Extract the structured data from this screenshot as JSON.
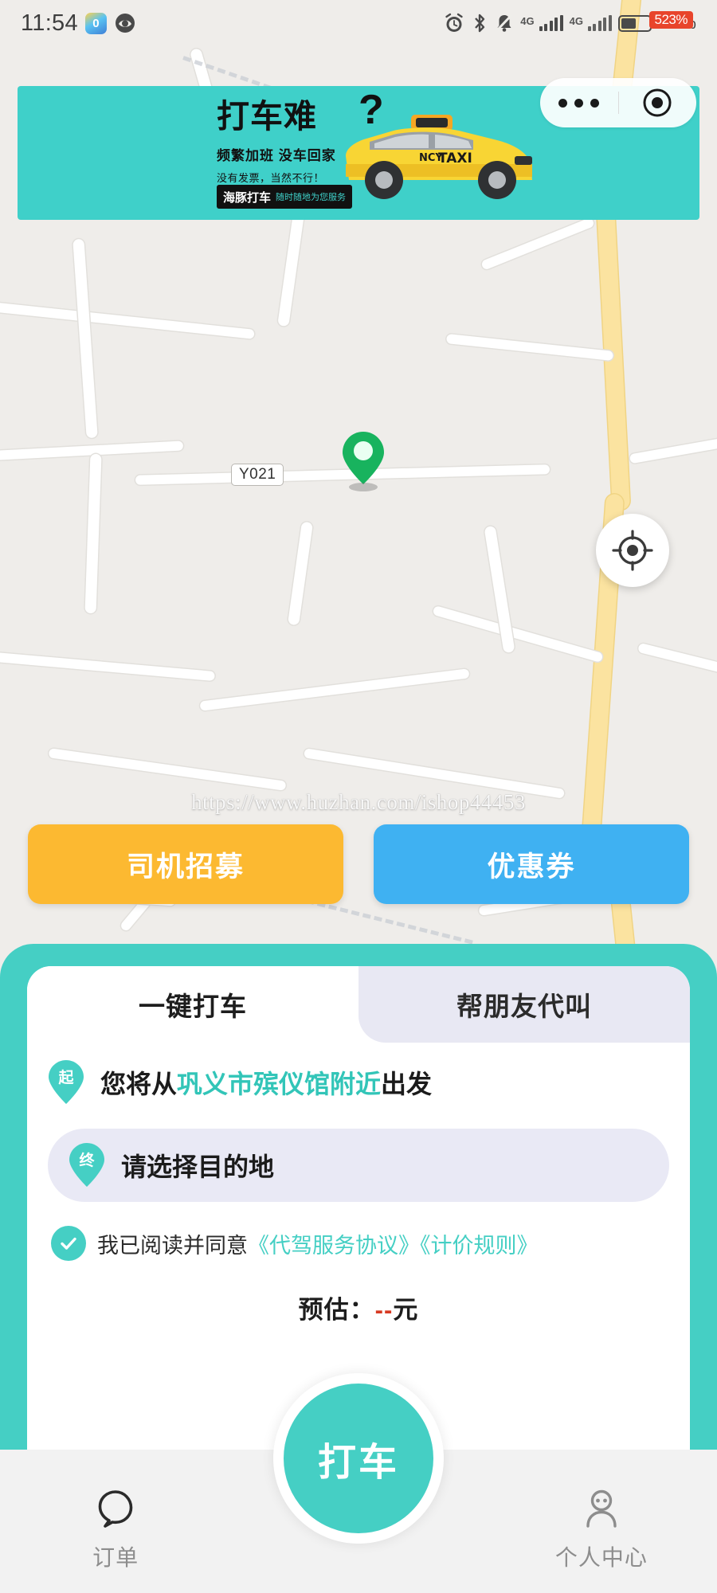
{
  "status_bar": {
    "time": "11:54",
    "app_badge_text": "0",
    "icons": [
      "app-icon",
      "eye-icon",
      "alarm-icon",
      "bluetooth-icon",
      "mute-bell-icon",
      "signal-icon",
      "signal-icon-2",
      "battery-icon"
    ],
    "network_label_1": "4G",
    "network_label_2": "4G",
    "battery_percent": "52%",
    "notification_badge": "523%"
  },
  "capsule": {
    "more_label": "more-dots",
    "target_label": "target-circle"
  },
  "banner": {
    "headline": "打车难",
    "question_mark": "?",
    "subline": "频繁加班  没车回家",
    "subline2": "没有发票，当然不行！",
    "chip_brand": "海豚打车",
    "chip_tag": "随时随地为您服务",
    "taxi_badge": "TAXI",
    "taxi_logo": "NCYTAXI",
    "bg_color": "#3fd0c9"
  },
  "map": {
    "road_label": "Y021",
    "pin_name": "origin-pin",
    "locate_button": "locate-me",
    "watermark": "https://www.huzhan.com/ishop44453"
  },
  "quick_actions": [
    {
      "label": "司机招募",
      "color": "#fcb931",
      "name": "driver-recruit"
    },
    {
      "label": "优惠券",
      "color": "#3fb1f2",
      "name": "coupon"
    }
  ],
  "booking": {
    "tabs": [
      {
        "label": "一键打车",
        "active": true
      },
      {
        "label": "帮朋友代叫",
        "active": false
      }
    ],
    "origin": {
      "pin_text": "起",
      "prefix": "您将从",
      "place": "巩义市殡仪馆附近",
      "suffix": "出发"
    },
    "destination": {
      "pin_text": "终",
      "placeholder": "请选择目的地"
    },
    "agreement": {
      "text": "我已阅读并同意",
      "link1": "《代驾服务协议》",
      "link2": "《计价规则》",
      "checked": true
    },
    "estimate": {
      "label": "预估：",
      "value": "--",
      "unit": "元"
    },
    "cta_label": "打车",
    "accent_color": "#45cfc4"
  },
  "bottom_nav": [
    {
      "label": "订单",
      "icon": "chat-bubble-icon",
      "name": "orders"
    },
    {
      "label": "个人中心",
      "icon": "person-icon",
      "name": "profile"
    }
  ]
}
